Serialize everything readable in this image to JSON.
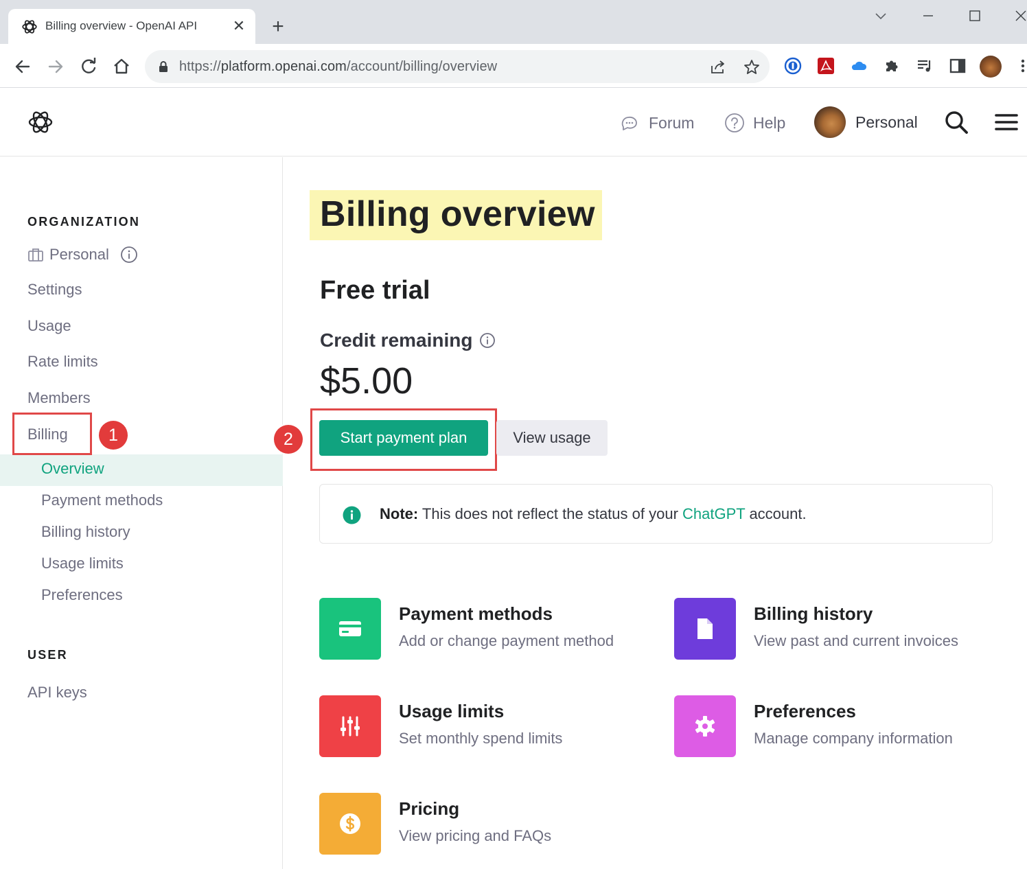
{
  "browser": {
    "tab_title": "Billing overview - OpenAI API",
    "tab_close": "✕",
    "new_tab": "+",
    "url_scheme": "https://",
    "url_host": "platform.openai.com",
    "url_path": "/account/billing/overview"
  },
  "header": {
    "forum_label": "Forum",
    "help_label": "Help",
    "account_label": "Personal"
  },
  "sidebar": {
    "org_heading": "ORGANIZATION",
    "org_name": "Personal",
    "items": [
      {
        "label": "Settings"
      },
      {
        "label": "Usage"
      },
      {
        "label": "Rate limits"
      },
      {
        "label": "Members"
      },
      {
        "label": "Billing"
      }
    ],
    "billing_sub": [
      {
        "label": "Overview",
        "active": true
      },
      {
        "label": "Payment methods"
      },
      {
        "label": "Billing history"
      },
      {
        "label": "Usage limits"
      },
      {
        "label": "Preferences"
      }
    ],
    "user_heading": "USER",
    "user_items": [
      {
        "label": "API keys"
      }
    ]
  },
  "annotations": {
    "badge_1": "1",
    "badge_2": "2"
  },
  "main": {
    "title": "Billing overview",
    "plan": "Free trial",
    "credit_label": "Credit remaining",
    "credit_amount": "$5.00",
    "primary_button": "Start payment plan",
    "secondary_button": "View usage",
    "note_bold": "Note:",
    "note_text": " This does not reflect the status of your ",
    "note_link": "ChatGPT",
    "note_end": " account.",
    "cards": [
      {
        "title": "Payment methods",
        "desc": "Add or change payment method",
        "color": "#19c37d",
        "icon": "credit-card-icon"
      },
      {
        "title": "Billing history",
        "desc": "View past and current invoices",
        "color": "#6e3cdb",
        "icon": "document-icon"
      },
      {
        "title": "Usage limits",
        "desc": "Set monthly spend limits",
        "color": "#ef4146",
        "icon": "sliders-icon"
      },
      {
        "title": "Preferences",
        "desc": "Manage company information",
        "color": "#dd5ce5",
        "icon": "gear-icon"
      },
      {
        "title": "Pricing",
        "desc": "View pricing and FAQs",
        "color": "#f4ac36",
        "icon": "dollar-icon"
      }
    ]
  },
  "colors": {
    "accent": "#10a37f",
    "title_highlight": "#fbf6b4",
    "annotation_red": "#e04848"
  }
}
